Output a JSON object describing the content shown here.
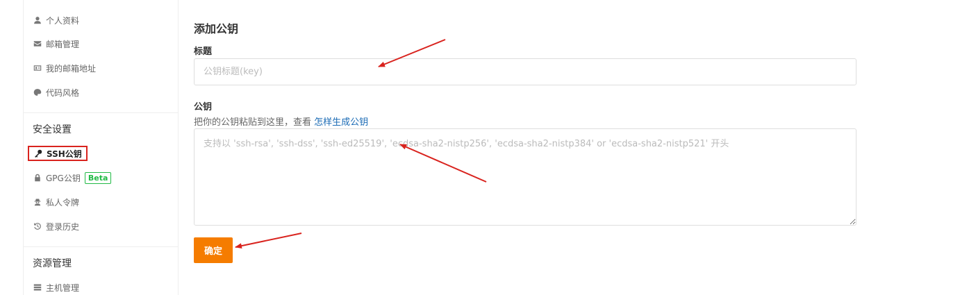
{
  "sidebar": {
    "items_top": [
      {
        "label": "个人资料",
        "icon": "user-icon"
      },
      {
        "label": "邮箱管理",
        "icon": "envelope-icon"
      },
      {
        "label": "我的邮箱地址",
        "icon": "id-card-icon"
      },
      {
        "label": "代码风格",
        "icon": "palette-icon"
      }
    ],
    "security_header": "安全设置",
    "security_items": [
      {
        "label": "SSH公钥",
        "icon": "key-icon",
        "active": true
      },
      {
        "label": "GPG公钥",
        "icon": "lock-icon",
        "badge": "Beta"
      },
      {
        "label": "私人令牌",
        "icon": "user-secret-icon"
      },
      {
        "label": "登录历史",
        "icon": "history-icon"
      }
    ],
    "resource_header": "资源管理",
    "resource_items": [
      {
        "label": "主机管理",
        "icon": "server-icon"
      }
    ]
  },
  "main": {
    "title": "添加公钥",
    "title_field_label": "标题",
    "title_placeholder": "公钥标题(key)",
    "key_field_label": "公钥",
    "key_hint_prefix": "把你的公钥粘贴到这里，查看",
    "key_hint_link": "怎样生成公钥",
    "key_placeholder": "支持以 'ssh-rsa', 'ssh-dss', 'ssh-ed25519', 'ecdsa-sha2-nistp256', 'ecdsa-sha2-nistp384' or 'ecdsa-sha2-nistp521' 开头",
    "submit_label": "确定"
  },
  "colors": {
    "accent": "#f57c00",
    "link": "#1b6bb5",
    "annotation": "#d9231e",
    "beta": "#21ba45"
  }
}
